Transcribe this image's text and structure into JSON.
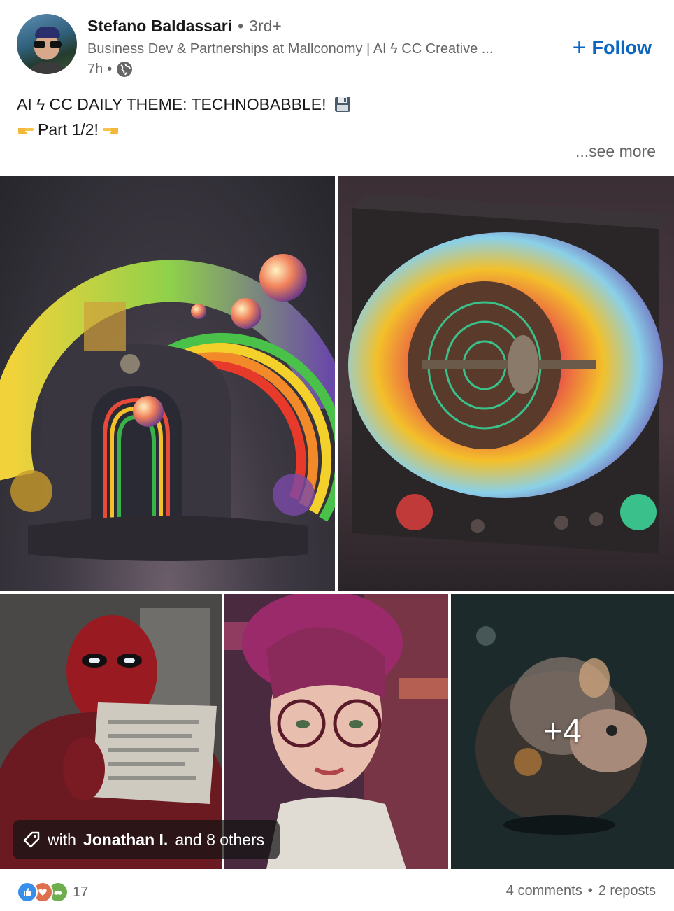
{
  "author": {
    "name": "Stefano Baldassari",
    "degree": "3rd+",
    "headline": "Business Dev & Partnerships at Mallconomy | AI ϟ CC Creative ...",
    "time": "7h"
  },
  "follow_label": "Follow",
  "post": {
    "line1": "AI ϟ CC DAILY THEME: TECHNOBABBLE!",
    "line2": "Part 1/2!",
    "see_more": "...see more"
  },
  "images": {
    "more_count": "+4",
    "tag_prefix": "with",
    "tag_name": "Jonathan I.",
    "tag_suffix": "and 8 others"
  },
  "reactions": {
    "count": "17",
    "comments": "4 comments",
    "reposts": "2 reposts"
  },
  "colors": {
    "link": "#0a66c2",
    "muted": "#666666",
    "like": "#378fe9",
    "love": "#df704d",
    "support": "#6dae4f"
  }
}
